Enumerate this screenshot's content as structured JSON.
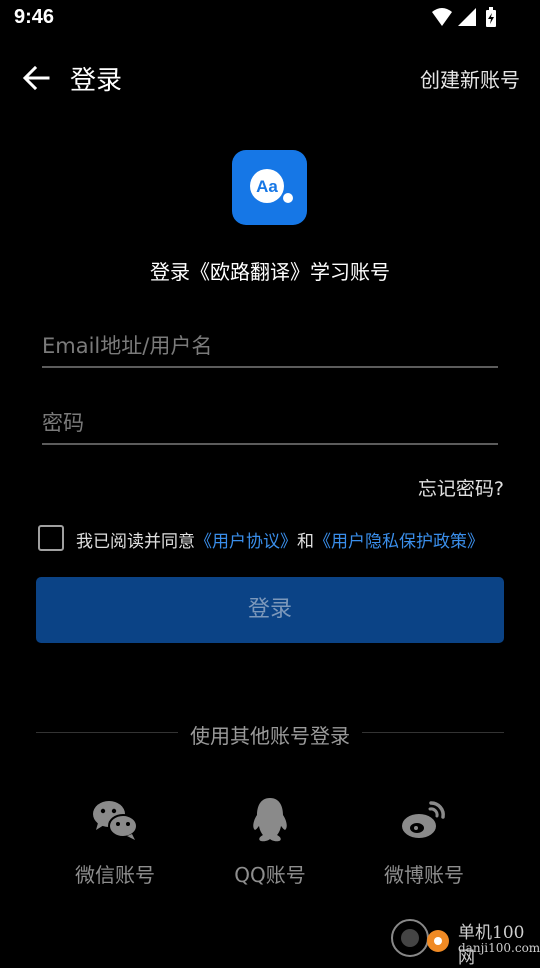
{
  "status_bar": {
    "time": "9:46"
  },
  "header": {
    "title": "登录",
    "create_account": "创建新账号"
  },
  "logo": {
    "text": "Aa"
  },
  "heading": "登录《欧路翻译》学习账号",
  "form": {
    "email_placeholder": "Email地址/用户名",
    "password_placeholder": "密码",
    "forgot": "忘记密码?",
    "agree_prefix": "我已阅读并同意",
    "user_agreement": "《用户协议》",
    "and": "和",
    "privacy_policy": "《用户隐私保护政策》",
    "login_button": "登录"
  },
  "other_login": {
    "divider": "使用其他账号登录",
    "items": [
      {
        "label": "微信账号",
        "icon": "wechat-icon"
      },
      {
        "label": "QQ账号",
        "icon": "qq-icon"
      },
      {
        "label": "微博账号",
        "icon": "weibo-icon"
      }
    ]
  },
  "watermark": {
    "cn": "单机100网",
    "en": "danji100.com"
  },
  "colors": {
    "accent": "#1677e6",
    "button": "#0b4386",
    "link": "#3a8eea"
  }
}
